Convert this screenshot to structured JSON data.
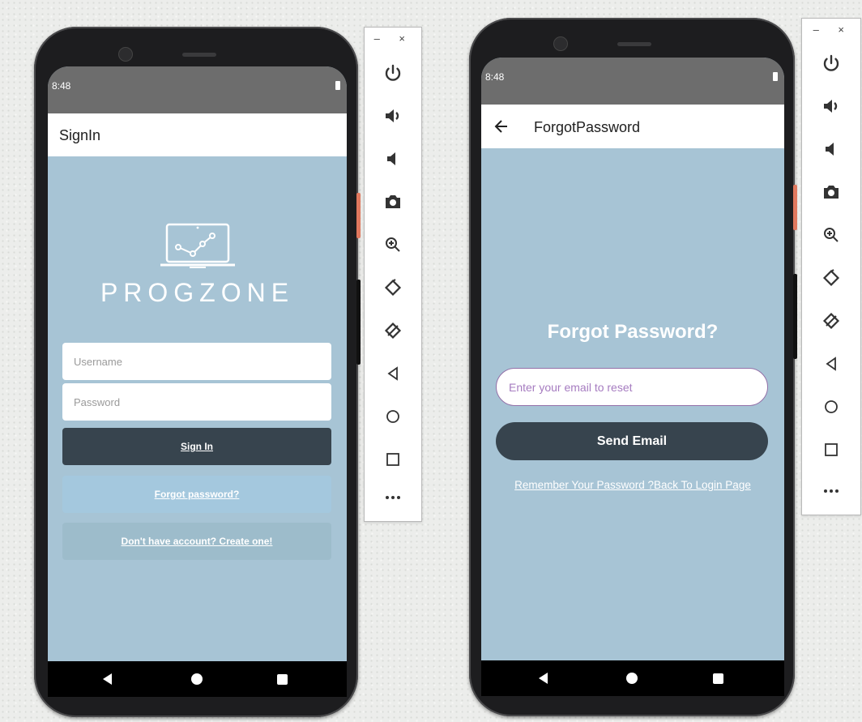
{
  "left_phone": {
    "status": {
      "time": "8:48"
    },
    "appbar": {
      "title": "SignIn"
    },
    "logo": {
      "text": "PROGZONE"
    },
    "username": {
      "placeholder": "Username"
    },
    "password": {
      "placeholder": "Password"
    },
    "signin_label": "Sign In",
    "forgot_label": "Forgot password?",
    "create_label": "Don't have account? Create one!"
  },
  "right_phone": {
    "status": {
      "time": "8:48"
    },
    "appbar": {
      "title": "ForgotPassword"
    },
    "heading": "Forgot Password?",
    "email": {
      "placeholder": "Enter your email to reset"
    },
    "send_label": "Send Email",
    "back_link": "Remember Your Password ?Back To Login Page"
  },
  "toolbar": {
    "window_controls": "– ×",
    "icons": [
      "power-icon",
      "volume-up-icon",
      "volume-down-icon",
      "camera-icon",
      "zoom-icon",
      "rotate-left-icon",
      "rotate-right-icon",
      "back-icon",
      "home-icon",
      "overview-icon",
      "more-icon"
    ]
  },
  "colors": {
    "screen_bg": "#a7c4d5",
    "dark_button": "#37444e",
    "forgot_button": "#a4c8de",
    "create_button": "#9dbccb",
    "status_bar": "#6d6d6d",
    "email_border": "#9370a8",
    "email_placeholder": "#a67cc0"
  }
}
